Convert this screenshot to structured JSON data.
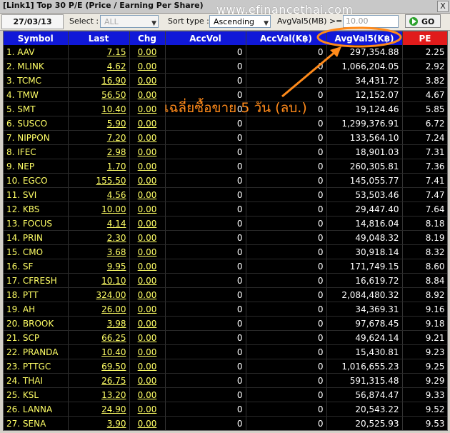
{
  "window": {
    "title": "[Link1] Top 30 P/E (Price / Earning Per Share)",
    "close_label": "X"
  },
  "watermark": "www.efinancethai.com",
  "toolbar": {
    "date": "27/03/13",
    "select_label": "Select :",
    "select_value": "ALL",
    "sort_label": "Sort type :",
    "sort_value": "Ascending",
    "filter_label": "AvgVal5(MB) >=",
    "filter_placeholder": "10.00",
    "go_label": "GO"
  },
  "annotation": {
    "text": "เฉลี่ยซื้อขาย 5 วัน (ลบ.)",
    "color": "#ff8a1a"
  },
  "colors": {
    "header": "#1018d8",
    "pe_header": "#e11b1b",
    "symbol": "#ffff66"
  },
  "table": {
    "columns": [
      "Symbol",
      "Last",
      "Chg",
      "AccVol",
      "AccVal(K฿)",
      "AvgVal5(K฿)",
      "PE"
    ],
    "rows": [
      [
        "1. AAV",
        "7.15",
        "0.00",
        "0",
        "0",
        "297,354.88",
        "2.25"
      ],
      [
        "2. MLINK",
        "4.62",
        "0.00",
        "0",
        "0",
        "1,066,204.05",
        "2.92"
      ],
      [
        "3. TCMC",
        "16.90",
        "0.00",
        "0",
        "0",
        "34,431.72",
        "3.82"
      ],
      [
        "4. TMW",
        "56.50",
        "0.00",
        "0",
        "0",
        "12,152.07",
        "4.67"
      ],
      [
        "5. SMT",
        "10.40",
        "0.00",
        "0",
        "0",
        "19,124.46",
        "5.85"
      ],
      [
        "6. SUSCO",
        "5.90",
        "0.00",
        "0",
        "0",
        "1,299,376.91",
        "6.72"
      ],
      [
        "7. NIPPON",
        "7.20",
        "0.00",
        "0",
        "0",
        "133,564.10",
        "7.24"
      ],
      [
        "8. IFEC",
        "2.98",
        "0.00",
        "0",
        "0",
        "18,901.03",
        "7.31"
      ],
      [
        "9. NEP",
        "1.70",
        "0.00",
        "0",
        "0",
        "260,305.81",
        "7.36"
      ],
      [
        "10. EGCO",
        "155.50",
        "0.00",
        "0",
        "0",
        "145,055.77",
        "7.41"
      ],
      [
        "11. SVI",
        "4.56",
        "0.00",
        "0",
        "0",
        "53,503.46",
        "7.47"
      ],
      [
        "12. KBS",
        "10.00",
        "0.00",
        "0",
        "0",
        "29,447.40",
        "7.64"
      ],
      [
        "13. FOCUS",
        "4.14",
        "0.00",
        "0",
        "0",
        "14,816.04",
        "8.18"
      ],
      [
        "14. PRIN",
        "2.30",
        "0.00",
        "0",
        "0",
        "49,048.32",
        "8.19"
      ],
      [
        "15. CMO",
        "3.68",
        "0.00",
        "0",
        "0",
        "30,918.14",
        "8.32"
      ],
      [
        "16. SF",
        "9.95",
        "0.00",
        "0",
        "0",
        "171,749.15",
        "8.60"
      ],
      [
        "17. CFRESH",
        "10.10",
        "0.00",
        "0",
        "0",
        "16,619.72",
        "8.84"
      ],
      [
        "18. PTT",
        "324.00",
        "0.00",
        "0",
        "0",
        "2,084,480.32",
        "8.92"
      ],
      [
        "19. AH",
        "26.00",
        "0.00",
        "0",
        "0",
        "34,369.31",
        "9.16"
      ],
      [
        "20. BROOK",
        "3.98",
        "0.00",
        "0",
        "0",
        "97,678.45",
        "9.18"
      ],
      [
        "21. SCP",
        "66.25",
        "0.00",
        "0",
        "0",
        "49,624.14",
        "9.21"
      ],
      [
        "22. PRANDA",
        "10.40",
        "0.00",
        "0",
        "0",
        "15,430.81",
        "9.23"
      ],
      [
        "23. PTTGC",
        "69.50",
        "0.00",
        "0",
        "0",
        "1,016,655.23",
        "9.25"
      ],
      [
        "24. THAI",
        "26.75",
        "0.00",
        "0",
        "0",
        "591,315.48",
        "9.29"
      ],
      [
        "25. KSL",
        "13.20",
        "0.00",
        "0",
        "0",
        "56,874.47",
        "9.33"
      ],
      [
        "26. LANNA",
        "24.90",
        "0.00",
        "0",
        "0",
        "20,543.22",
        "9.52"
      ],
      [
        "27. SENA",
        "3.90",
        "0.00",
        "0",
        "0",
        "20,525.93",
        "9.53"
      ]
    ]
  }
}
